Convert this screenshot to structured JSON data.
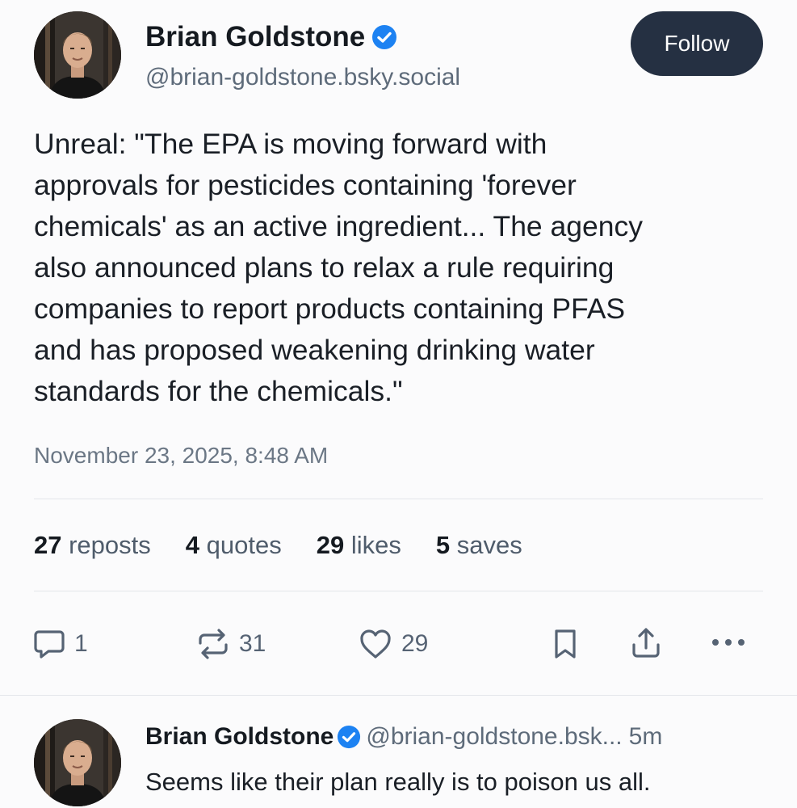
{
  "post": {
    "author": {
      "name": "Brian Goldstone",
      "handle": "@brian-goldstone.bsky.social",
      "verified": true,
      "avatar_icon": "avatar-photo"
    },
    "follow_label": "Follow",
    "text_lines": [
      "Unreal: \"The EPA is moving forward with",
      "approvals for pesticides containing 'forever",
      "chemicals' as an active ingredient... The agency",
      "also announced plans to relax a rule requiring",
      "companies to report products containing PFAS",
      "and has proposed weakening drinking water",
      "standards for the chemicals.\""
    ],
    "timestamp": "November 23, 2025, 8:48 AM",
    "stats": [
      {
        "count": "27",
        "label": "reposts"
      },
      {
        "count": "4",
        "label": "quotes"
      },
      {
        "count": "29",
        "label": "likes"
      },
      {
        "count": "5",
        "label": "saves"
      }
    ],
    "actions": {
      "reply": {
        "icon": "reply-bubble-icon",
        "count": "1"
      },
      "repost": {
        "icon": "repost-icon",
        "count": "31"
      },
      "like": {
        "icon": "heart-icon",
        "count": "29"
      },
      "bookmark": {
        "icon": "bookmark-icon"
      },
      "share": {
        "icon": "share-icon"
      },
      "more": {
        "icon": "more-icon"
      }
    }
  },
  "reply": {
    "author": {
      "name": "Brian Goldstone",
      "handle": "@brian-goldstone.bsk...",
      "verified": true
    },
    "time": "5m",
    "text": "Seems like their plan really is to poison us all."
  },
  "colors": {
    "background": "#fbfbfc",
    "follow_button": "#253042",
    "verified_badge": "#1d82f2",
    "secondary_text": "#5e6b7a"
  }
}
